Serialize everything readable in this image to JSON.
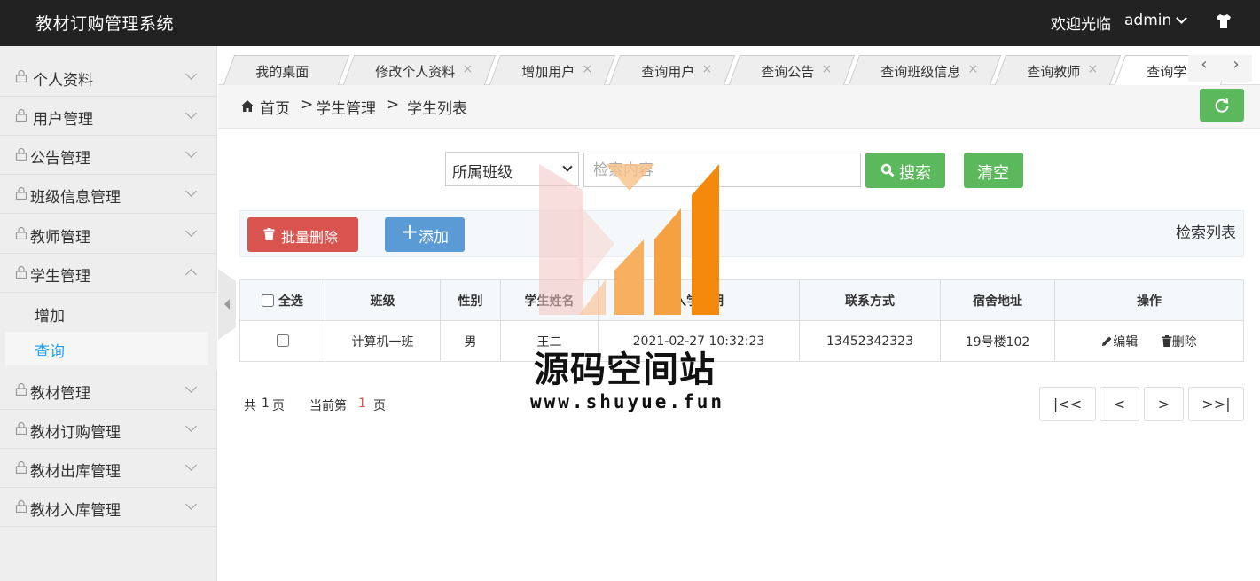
{
  "header": {
    "title": "教材订购管理系统",
    "welcome": "欢迎光临",
    "user": "admin"
  },
  "sidebar": {
    "items": [
      {
        "label": "个人资料"
      },
      {
        "label": "用户管理"
      },
      {
        "label": "公告管理"
      },
      {
        "label": "班级信息管理"
      },
      {
        "label": "教师管理"
      },
      {
        "label": "学生管理"
      },
      {
        "label": "教材管理"
      },
      {
        "label": "教材订购管理"
      },
      {
        "label": "教材出库管理"
      },
      {
        "label": "教材入库管理"
      }
    ],
    "student_sub": [
      {
        "label": "增加"
      },
      {
        "label": "查询"
      }
    ]
  },
  "tabs": [
    {
      "label": "我的桌面",
      "close": ""
    },
    {
      "label": "修改个人资料",
      "close": "×"
    },
    {
      "label": "增加用户",
      "close": "×"
    },
    {
      "label": "查询用户",
      "close": "×"
    },
    {
      "label": "查询公告",
      "close": "×"
    },
    {
      "label": "查询班级信息",
      "close": "×"
    },
    {
      "label": "查询教师",
      "close": "×"
    },
    {
      "label": "查询学",
      "close": ""
    }
  ],
  "tab_nav": {
    "prev": "‹",
    "next": "›"
  },
  "breadcrumb": {
    "home": "首页",
    "level1": "学生管理",
    "level2": "学生列表",
    "sep": ">"
  },
  "search": {
    "select_value": "所属班级",
    "placeholder": "检索内容",
    "search_label": "搜索",
    "clear_label": "清空"
  },
  "toolbar": {
    "batch_delete": "批量删除",
    "add": "添加",
    "list_title": "检索列表"
  },
  "table": {
    "select_all": "全选",
    "headers": [
      "班级",
      "性别",
      "学生姓名",
      "入学日期",
      "联系方式",
      "宿舍地址",
      "操作"
    ],
    "rows": [
      {
        "class": "计算机一班",
        "gender": "男",
        "name": "王二",
        "date": "2021-02-27 10:32:23",
        "phone": "13452342323",
        "dorm": "19号楼102"
      }
    ],
    "edit": "编辑",
    "delete": "删除"
  },
  "pagination": {
    "total_prefix": "共",
    "total": "1",
    "total_suffix": "页",
    "current_prefix": "当前第",
    "current": "1",
    "current_suffix": "页",
    "first": "|<<",
    "prev": "<",
    "next": ">",
    "last": ">>|"
  },
  "watermark": {
    "title": "源码空间站",
    "url": "www.shuyue.fun"
  },
  "colors": {
    "header_bg": "#222222",
    "accent_blue": "#1e9fff",
    "green": "#5cb85c",
    "red": "#d9534f",
    "blue_btn": "#5b9bd5",
    "watermark_orange": "#f5890c"
  }
}
